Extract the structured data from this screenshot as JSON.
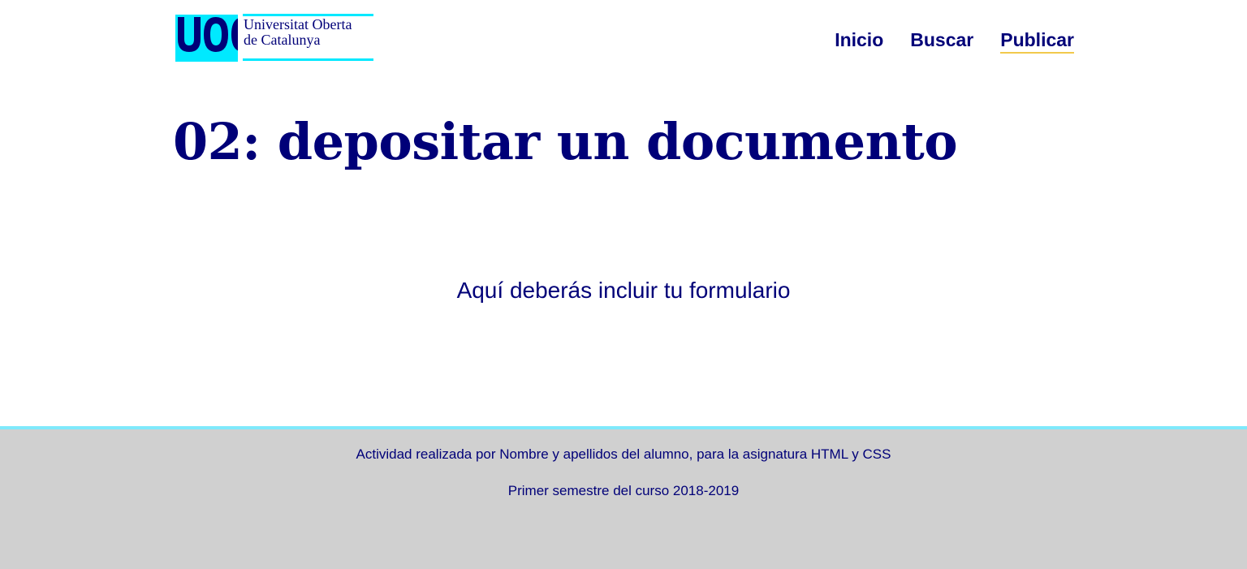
{
  "header": {
    "logo": {
      "monogram": "UOC",
      "line1": "Universitat Oberta",
      "line2": "de Catalunya"
    },
    "nav": [
      {
        "label": "Inicio",
        "active": false
      },
      {
        "label": "Buscar",
        "active": false
      },
      {
        "label": "Publicar",
        "active": true
      }
    ]
  },
  "main": {
    "title": "02: depositar un documento",
    "placeholder": "Aquí deberás incluir tu formulario"
  },
  "footer": {
    "line1": "Actividad realizada por Nombre y apellidos del alumno, para la asignatura HTML y CSS",
    "line2": "Primer semestre del curso 2018-2019"
  },
  "colors": {
    "text": "#000078",
    "logo_cyan": "#00e9ff",
    "footer_bg": "#d0d0d0",
    "footer_border": "#7fe9fb",
    "active_underline": "#f2c94c"
  }
}
